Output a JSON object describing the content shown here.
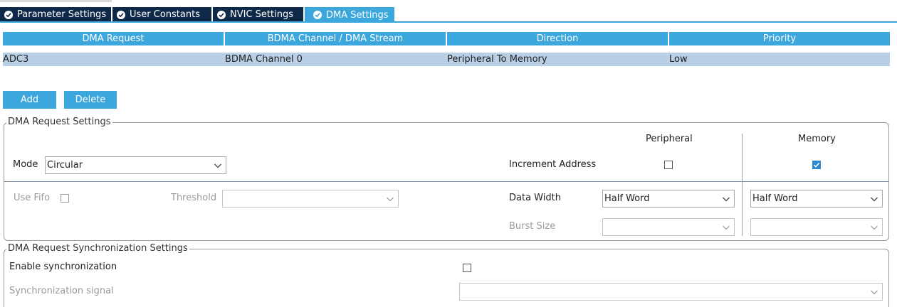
{
  "tabs": [
    {
      "label": "Parameter Settings",
      "active": false
    },
    {
      "label": "User Constants",
      "active": false
    },
    {
      "label": "NVIC Settings",
      "active": false
    },
    {
      "label": "DMA Settings",
      "active": true
    }
  ],
  "table": {
    "headers": [
      "DMA Request",
      "BDMA Channel / DMA Stream",
      "Direction",
      "Priority"
    ],
    "rows": [
      [
        "ADC3",
        "BDMA Channel 0",
        "Peripheral To Memory",
        "Low"
      ]
    ]
  },
  "buttons": {
    "add": "Add",
    "delete": "Delete"
  },
  "request_settings": {
    "legend": "DMA Request Settings",
    "peripheral_header": "Peripheral",
    "memory_header": "Memory",
    "mode_label": "Mode",
    "mode_value": "Circular",
    "increment_label": "Increment Address",
    "peripheral_increment": false,
    "memory_increment": true,
    "use_fifo_label": "Use Fifo",
    "threshold_label": "Threshold",
    "threshold_value": "",
    "data_width_label": "Data Width",
    "peripheral_data_width": "Half Word",
    "memory_data_width": "Half Word",
    "burst_size_label": "Burst Size",
    "peripheral_burst": "",
    "memory_burst": ""
  },
  "sync_settings": {
    "legend": "DMA Request Synchronization Settings",
    "enable_label": "Enable synchronization",
    "signal_label": "Synchronization signal",
    "signal_value": ""
  },
  "colors": {
    "accent": "#3ba7dc",
    "tab_dark": "#0f2948",
    "row_selected": "#b9cfe5"
  }
}
